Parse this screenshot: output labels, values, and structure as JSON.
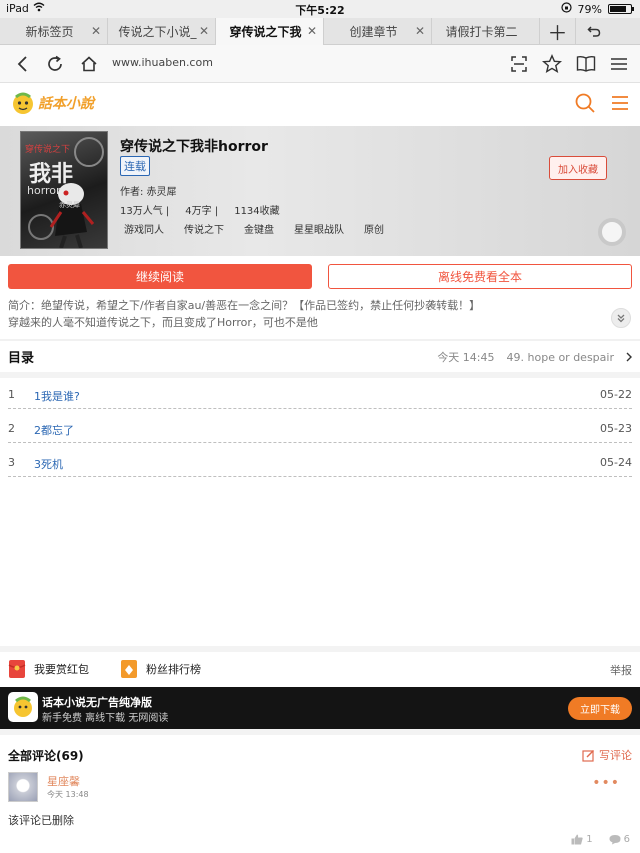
{
  "status_bar": {
    "device": "iPad",
    "time": "下午5:22",
    "battery": "79%",
    "battery_level": 0.79
  },
  "tabs": [
    {
      "label": "新标签页",
      "active": false
    },
    {
      "label": "传说之下小说_",
      "active": false
    },
    {
      "label": "穿传说之下我",
      "active": true
    },
    {
      "label": "创建章节",
      "active": false
    },
    {
      "label": "请假打卡第二",
      "active": false
    }
  ],
  "address_bar": {
    "url": "www.ihuaben.com"
  },
  "site": {
    "logo_text": "話本小說"
  },
  "book": {
    "title": "穿传说之下我非horror",
    "status_badge": "连载",
    "author": "作者: 赤灵犀",
    "stats": [
      "13万人气 |",
      "4万字 |",
      "1134收藏"
    ],
    "tags": [
      "游戏同人",
      "传说之下",
      "金键盘",
      "星星眼战队",
      "原创"
    ],
    "favorite_label": "加入收藏",
    "cover_text": {
      "top": "穿传说之下",
      "big": "我非",
      "horror": "horror",
      "author": "赤灵犀"
    }
  },
  "actions": {
    "continue_read": "继续阅读",
    "offline_read": "离线免费看全本"
  },
  "intro": {
    "line1": "简介：绝望传说，希望之下/作者自家au/善恶在一念之间？【作品已签约，禁止任何抄袭转载！】",
    "line2": "穿越来的人毫不知道传说之下，而且变成了Horror，可也不是他"
  },
  "toc": {
    "title": "目录",
    "latest_time": "今天 14:45",
    "latest_chapter": "49. hope or despair",
    "chapters": [
      {
        "num": "1",
        "name": "1我是谁?",
        "date": "05-22"
      },
      {
        "num": "2",
        "name": "2都忘了",
        "date": "05-23"
      },
      {
        "num": "3",
        "name": "3死机",
        "date": "05-24"
      }
    ]
  },
  "reward": {
    "red_packet": "我要赏红包",
    "fan_rank": "粉丝排行榜",
    "report": "举报"
  },
  "ad": {
    "title": "话本小说无广告纯净版",
    "subtitle": "新手免费 离线下载 无网阅读",
    "button": "立即下载"
  },
  "comments": {
    "title": "全部评论(69)",
    "write": "写评论",
    "items": [
      {
        "user": "星座馨",
        "time": "今天 13:48",
        "text": "该评论已删除",
        "likes": "1",
        "replies": "6"
      }
    ]
  },
  "colors": {
    "accent": "#f1553f",
    "link": "#2b67b3",
    "ad_button": "#f07b25",
    "logo": "#f1a02b"
  }
}
